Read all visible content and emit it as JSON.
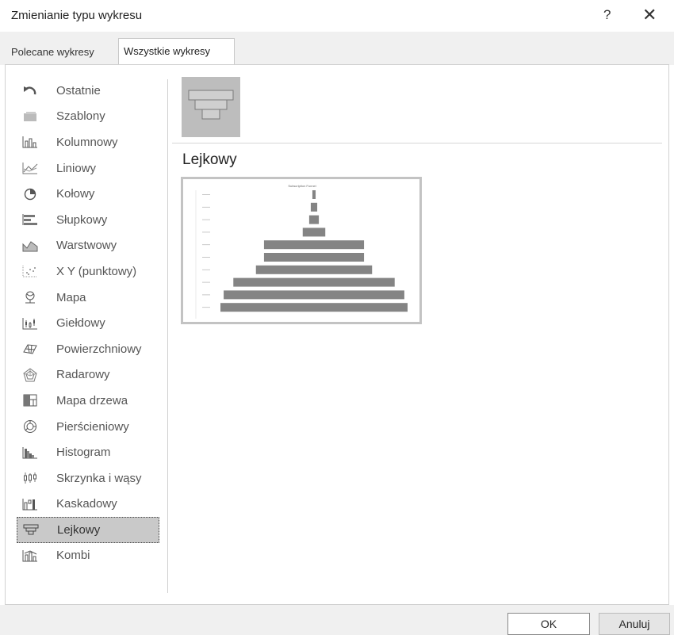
{
  "window": {
    "title": "Zmienianie typu wykresu",
    "help": "?",
    "close": "✕"
  },
  "tabs": [
    {
      "label": "Polecane wykresy"
    },
    {
      "label": "Wszystkie wykresy"
    }
  ],
  "sidebar": {
    "items": [
      {
        "label": "Ostatnie",
        "icon": "recent-icon"
      },
      {
        "label": "Szablony",
        "icon": "templates-icon"
      },
      {
        "label": "Kolumnowy",
        "icon": "column-chart-icon"
      },
      {
        "label": "Liniowy",
        "icon": "line-chart-icon"
      },
      {
        "label": "Kołowy",
        "icon": "pie-chart-icon"
      },
      {
        "label": "Słupkowy",
        "icon": "bar-chart-icon"
      },
      {
        "label": "Warstwowy",
        "icon": "area-chart-icon"
      },
      {
        "label": "X Y (punktowy)",
        "icon": "scatter-chart-icon"
      },
      {
        "label": "Mapa",
        "icon": "map-chart-icon"
      },
      {
        "label": "Giełdowy",
        "icon": "stock-chart-icon"
      },
      {
        "label": "Powierzchniowy",
        "icon": "surface-chart-icon"
      },
      {
        "label": "Radarowy",
        "icon": "radar-chart-icon"
      },
      {
        "label": "Mapa drzewa",
        "icon": "treemap-chart-icon"
      },
      {
        "label": "Pierścieniowy",
        "icon": "sunburst-chart-icon"
      },
      {
        "label": "Histogram",
        "icon": "histogram-chart-icon"
      },
      {
        "label": "Skrzynka i wąsy",
        "icon": "box-whisker-chart-icon"
      },
      {
        "label": "Kaskadowy",
        "icon": "waterfall-chart-icon"
      },
      {
        "label": "Lejkowy",
        "icon": "funnel-chart-icon",
        "selected": true
      },
      {
        "label": "Kombi",
        "icon": "combo-chart-icon"
      }
    ]
  },
  "main": {
    "subtitle": "Lejkowy"
  },
  "preview_chart": {
    "type": "bar",
    "title_text": "Subscription Funnel",
    "values": [
      1,
      2,
      3,
      7,
      31,
      31,
      36,
      50,
      56,
      58
    ],
    "max": 58
  },
  "buttons": {
    "ok": "OK",
    "cancel": "Anuluj"
  }
}
